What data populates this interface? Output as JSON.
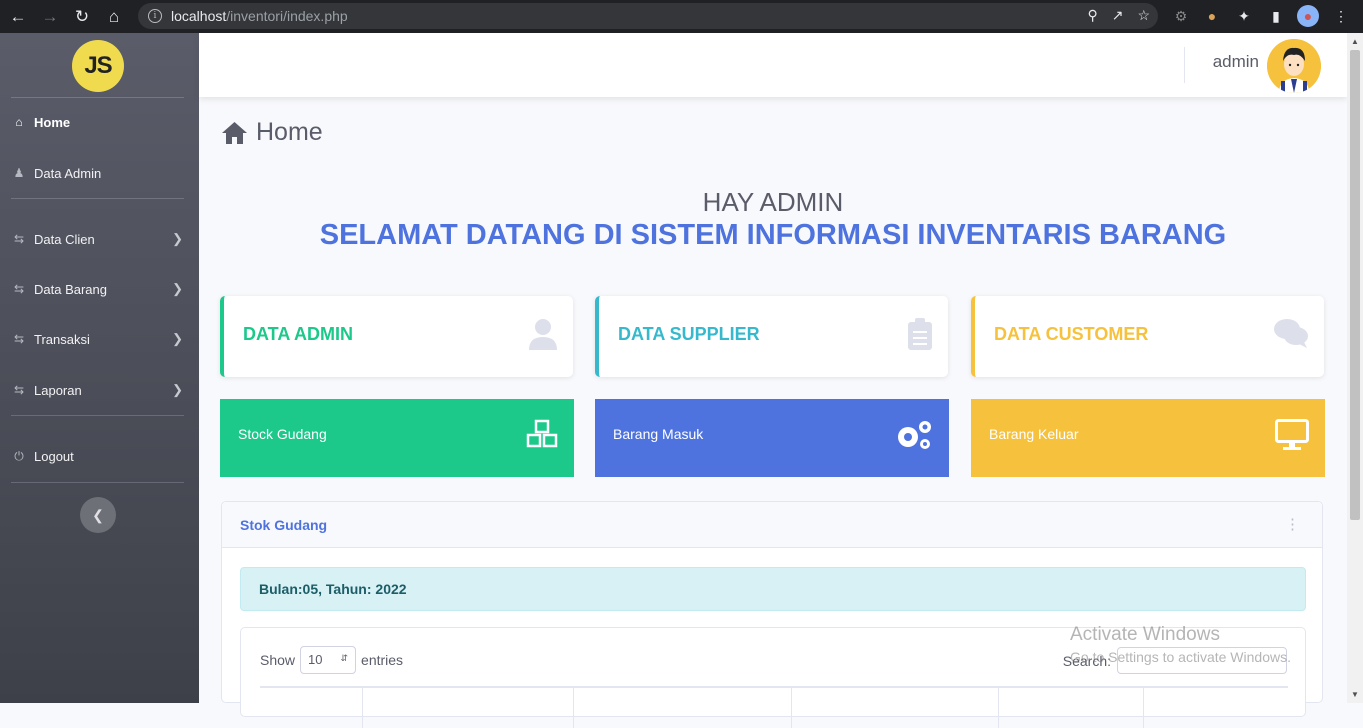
{
  "browser": {
    "url_host": "localhost",
    "url_path": "/inventori/index.php"
  },
  "sidebar": {
    "logo_text": "JS",
    "items": [
      {
        "label": "Home",
        "icon": "home-icon",
        "active": true
      },
      {
        "label": "Data Admin",
        "icon": "user-icon"
      },
      {
        "label": "Data Clien",
        "icon": "exchange-icon"
      },
      {
        "label": "Data Barang",
        "icon": "exchange-icon"
      },
      {
        "label": "Transaksi",
        "icon": "exchange-icon"
      },
      {
        "label": "Laporan",
        "icon": "exchange-icon"
      },
      {
        "label": "Logout",
        "icon": "power-icon"
      }
    ]
  },
  "topbar": {
    "username": "admin"
  },
  "page": {
    "title": "Home",
    "greeting": "HAY ADMIN",
    "welcome": "SELAMAT DATANG DI SISTEM INFORMASI INVENTARIS BARANG"
  },
  "cards": [
    {
      "label": "DATA ADMIN",
      "color": "#1cc88a",
      "icon": "user-icon"
    },
    {
      "label": "DATA SUPPLIER",
      "color": "#36b9cc",
      "icon": "clipboard-icon"
    },
    {
      "label": "DATA CUSTOMER",
      "color": "#f6c23e",
      "icon": "comments-icon"
    }
  ],
  "tiles": [
    {
      "label": "Stock Gudang",
      "color": "#1cc88a",
      "icon": "cubes-icon"
    },
    {
      "label": "Barang Masuk",
      "color": "#4e73df",
      "icon": "cogs-icon"
    },
    {
      "label": "Barang Keluar",
      "color": "#f6c23e",
      "icon": "desktop-icon"
    }
  ],
  "stock_panel": {
    "title": "Stok Gudang",
    "period": "Bulan:05, Tahun: 2022",
    "show_label": "Show",
    "entries_value": "10",
    "entries_label": "entries",
    "search_label": "Search:"
  },
  "watermark": {
    "line1": "Activate Windows",
    "line2": "Go to Settings to activate Windows."
  }
}
